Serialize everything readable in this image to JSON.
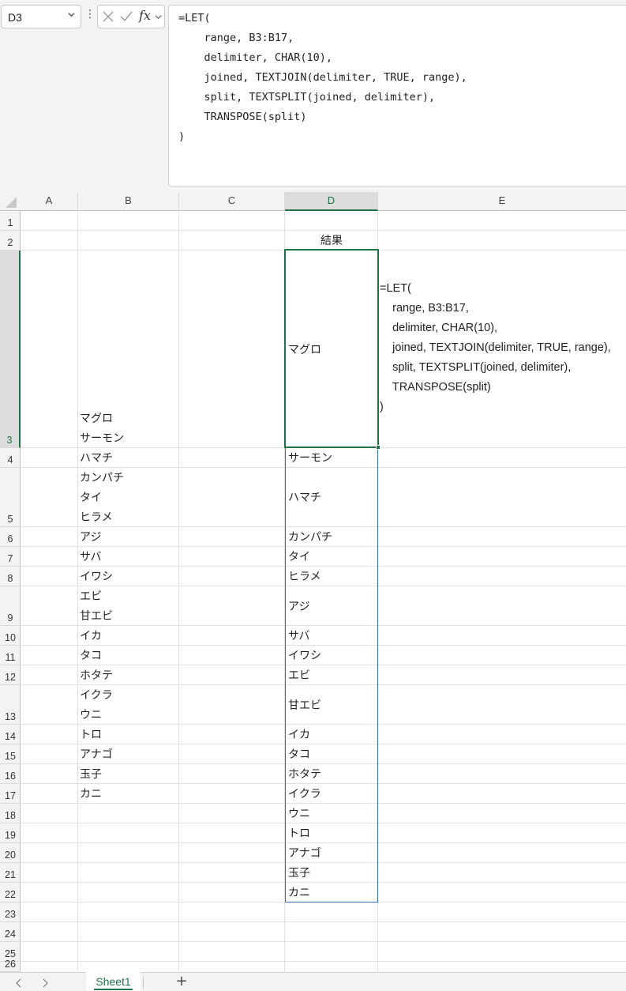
{
  "name_box": {
    "value": "D3"
  },
  "formula_bar": {
    "lines": [
      "=LET(",
      "    range, B3:B17,",
      "    delimiter, CHAR(10),",
      "    joined, TEXTJOIN(delimiter, TRUE, range),",
      "    split, TEXTSPLIT(joined, delimiter),",
      "    TRANSPOSE(split)",
      ")"
    ]
  },
  "columns": [
    "A",
    "B",
    "C",
    "D",
    "E"
  ],
  "selected_cell": {
    "column": "D",
    "row": "3"
  },
  "rows": [
    "1",
    "2",
    "3",
    "4",
    "5",
    "6",
    "7",
    "8",
    "9",
    "10",
    "11",
    "12",
    "13",
    "14",
    "15",
    "16",
    "17",
    "18",
    "19",
    "20",
    "21",
    "22",
    "23",
    "24",
    "25",
    "26"
  ],
  "header_cell": {
    "address": "D2",
    "value": "結果"
  },
  "column_b": [
    {
      "row": "3",
      "value": "マグロ\nサーモン"
    },
    {
      "row": "4",
      "value": "ハマチ"
    },
    {
      "row": "5",
      "value": "カンパチ\nタイ\nヒラメ"
    },
    {
      "row": "6",
      "value": "アジ"
    },
    {
      "row": "7",
      "value": "サバ"
    },
    {
      "row": "8",
      "value": "イワシ"
    },
    {
      "row": "9",
      "value": "エビ\n甘エビ"
    },
    {
      "row": "10",
      "value": "イカ"
    },
    {
      "row": "11",
      "value": "タコ"
    },
    {
      "row": "12",
      "value": "ホタテ"
    },
    {
      "row": "13",
      "value": "イクラ\nウニ"
    },
    {
      "row": "14",
      "value": "トロ"
    },
    {
      "row": "15",
      "value": "アナゴ"
    },
    {
      "row": "16",
      "value": "玉子"
    },
    {
      "row": "17",
      "value": "カニ"
    }
  ],
  "column_d": [
    "マグロ",
    "サーモン",
    "ハマチ",
    "カンパチ",
    "タイ",
    "ヒラメ",
    "アジ",
    "サバ",
    "イワシ",
    "エビ",
    "甘エビ",
    "イカ",
    "タコ",
    "ホタテ",
    "イクラ",
    "ウニ",
    "トロ",
    "アナゴ",
    "玉子",
    "カニ"
  ],
  "cell_e3": {
    "text": "=LET(\n    range, B3:B17,\n    delimiter, CHAR(10),\n    joined, TEXTJOIN(delimiter, TRUE, range),\n    split, TEXTSPLIT(joined, delimiter),\n    TRANSPOSE(split)\n)"
  },
  "sheet_tabs": [
    {
      "label": "Sheet1",
      "active": true
    }
  ],
  "add_sheet_label": "+",
  "icons": {
    "cancel": "close-icon",
    "enter": "check-icon",
    "function": "fx-icon"
  },
  "colors": {
    "accent": "#217346",
    "spill_border": "#2f6fc4"
  }
}
